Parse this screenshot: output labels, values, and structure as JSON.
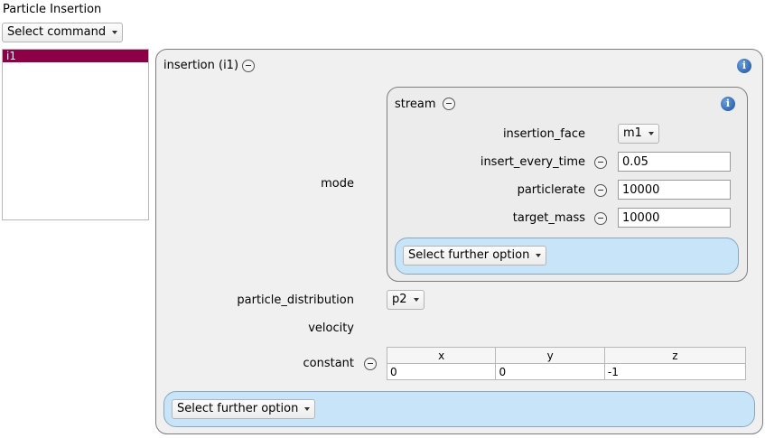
{
  "panel": {
    "title": "Particle Insertion",
    "command_select": "Select command",
    "list_items": [
      "i1"
    ]
  },
  "insertion": {
    "title": "insertion (i1)",
    "mode_label": "mode",
    "stream": {
      "title": "stream",
      "insertion_face_label": "insertion_face",
      "insertion_face_value": "m1",
      "insert_every_time_label": "insert_every_time",
      "insert_every_time_value": "0.05",
      "particlerate_label": "particlerate",
      "particlerate_value": "10000",
      "target_mass_label": "target_mass",
      "target_mass_value": "10000",
      "further_option": "Select further option"
    },
    "particle_distribution_label": "particle_distribution",
    "particle_distribution_value": "p2",
    "velocity_label": "velocity",
    "constant_label": "constant",
    "vector_headers": [
      "x",
      "y",
      "z"
    ],
    "vector_values": [
      "0",
      "0",
      "-1"
    ],
    "further_option": "Select further option"
  },
  "icons": {
    "info": "info-icon",
    "remove": "minus-circle-icon",
    "dropdown": "caret-down-icon"
  },
  "colors": {
    "selection": "#8c0046",
    "option_bar": "#c8e4f8",
    "info_blue": "#1b4f9c"
  }
}
